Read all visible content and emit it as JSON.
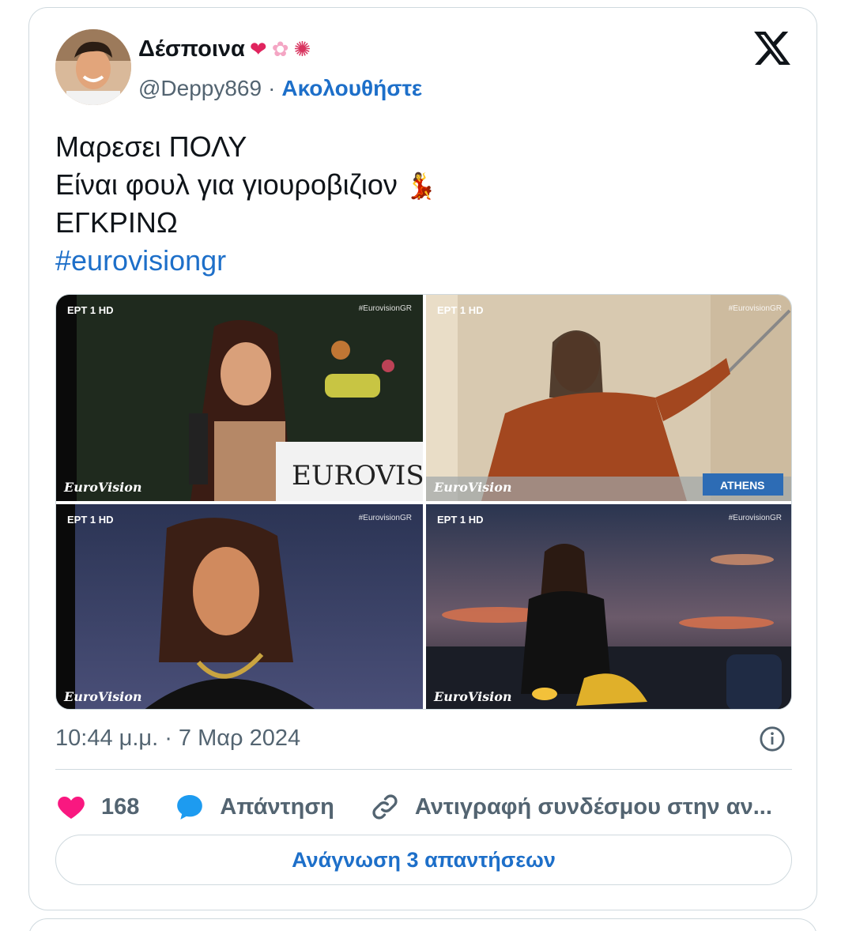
{
  "author": {
    "display_name": "Δέσποινα",
    "name_emojis": [
      "heart-emoji",
      "cherry-blossom-emoji",
      "candy-emoji"
    ],
    "handle": "@Deppy869",
    "separator": "·",
    "follow_label": "Ακολουθήστε"
  },
  "tweet": {
    "lines": [
      "Μαρεσει ΠΟΛΥ",
      "Είναι φουλ για γιουροβιζιον",
      "ΕΓΚΡΙΝΩ"
    ],
    "line2_emoji": "dancer-emoji",
    "hashtag": "#eurovisiongr",
    "timestamp": "10:44 μ.μ. · 7 Μαρ 2024"
  },
  "media": {
    "images": [
      {
        "channel": "ΕΡΤ 1 HD",
        "tag": "#EurovisionGR",
        "logo": "EuroVision",
        "sign": "EUROVISI"
      },
      {
        "channel": "ΕΡΤ 1 HD",
        "tag": "#EurovisionGR",
        "logo": "EuroVision",
        "banner": "ATHENS"
      },
      {
        "channel": "ΕΡΤ 1 HD",
        "tag": "#EurovisionGR",
        "logo": "EuroVision"
      },
      {
        "channel": "ΕΡΤ 1 HD",
        "tag": "#EurovisionGR",
        "logo": "EuroVision"
      }
    ]
  },
  "actions": {
    "likes": "168",
    "reply_label": "Απάντηση",
    "copy_label": "Αντιγραφή συνδέσμου στην αν..."
  },
  "read_replies_label": "Ανάγνωση 3 απαντήσεων",
  "colors": {
    "link": "#1d6fc9",
    "like": "#f91880",
    "reply": "#1d9bf0",
    "muted": "#536471",
    "border": "#cfd9de"
  }
}
